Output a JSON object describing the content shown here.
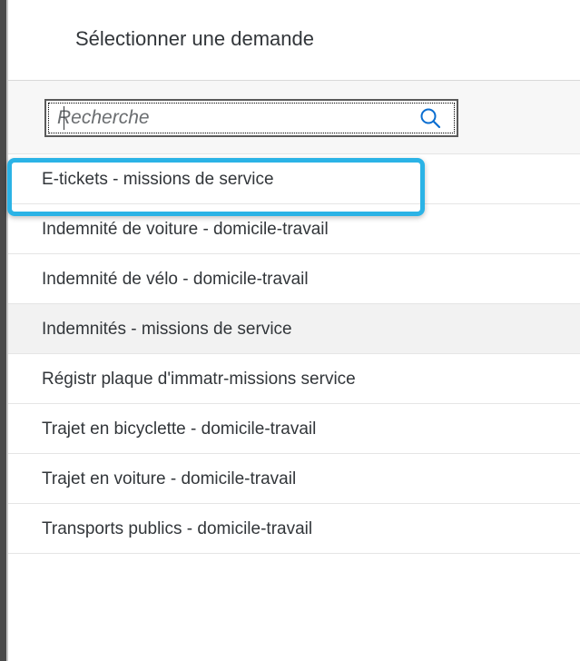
{
  "dialog": {
    "title": "Sélectionner une demande"
  },
  "search": {
    "placeholder": "Recherche",
    "value": ""
  },
  "list": {
    "items": [
      {
        "label": "E-tickets - missions de service"
      },
      {
        "label": "Indemnité de voiture - domicile-travail"
      },
      {
        "label": "Indemnité de vélo - domicile-travail"
      },
      {
        "label": "Indemnités - missions de service"
      },
      {
        "label": "Régistr plaque d'immatr-missions service"
      },
      {
        "label": "Trajet en bicyclette - domicile-travail"
      },
      {
        "label": "Trajet en voiture - domicile-travail"
      },
      {
        "label": "Transports publics - domicile-travail"
      }
    ]
  },
  "colors": {
    "highlight": "#2bb3e6",
    "text": "#32363a",
    "icon": "#0a6ed1"
  },
  "icons": {
    "search": "search-icon"
  }
}
